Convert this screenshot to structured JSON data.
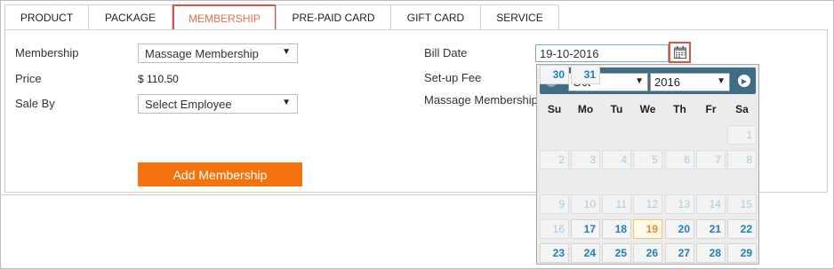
{
  "tabs": [
    "PRODUCT",
    "PACKAGE",
    "MEMBERSHIP",
    "PRE-PAID CARD",
    "GIFT CARD",
    "SERVICE"
  ],
  "active_tab": "MEMBERSHIP",
  "form": {
    "membership_label": "Membership",
    "membership_value": "Massage Membership",
    "price_label": "Price",
    "price_value": "$ 110.50",
    "sale_by_label": "Sale By",
    "sale_by_value": "Select Employee",
    "add_button": "Add Membership",
    "bill_date_label": "Bill Date",
    "bill_date_value": "19-10-2016",
    "setup_fee_label": "Set-up Fee",
    "massage_membership_label": "Massage Membership"
  },
  "calendar": {
    "month": "Oct",
    "year": "2016",
    "weekdays": [
      "Su",
      "Mo",
      "Tu",
      "We",
      "Th",
      "Fr",
      "Sa"
    ],
    "first_weekday_index": 6,
    "days_in_month": 31,
    "today": 19,
    "disabled_before": 17
  },
  "icons": {
    "calendar": "calendar-icon",
    "prev": "chevron-left-icon",
    "next": "chevron-right-icon"
  },
  "colors": {
    "accent": "#e8704a",
    "button": "#f5730e",
    "calendar_header": "#3f6d88",
    "active_day": "#1e7fb8"
  }
}
